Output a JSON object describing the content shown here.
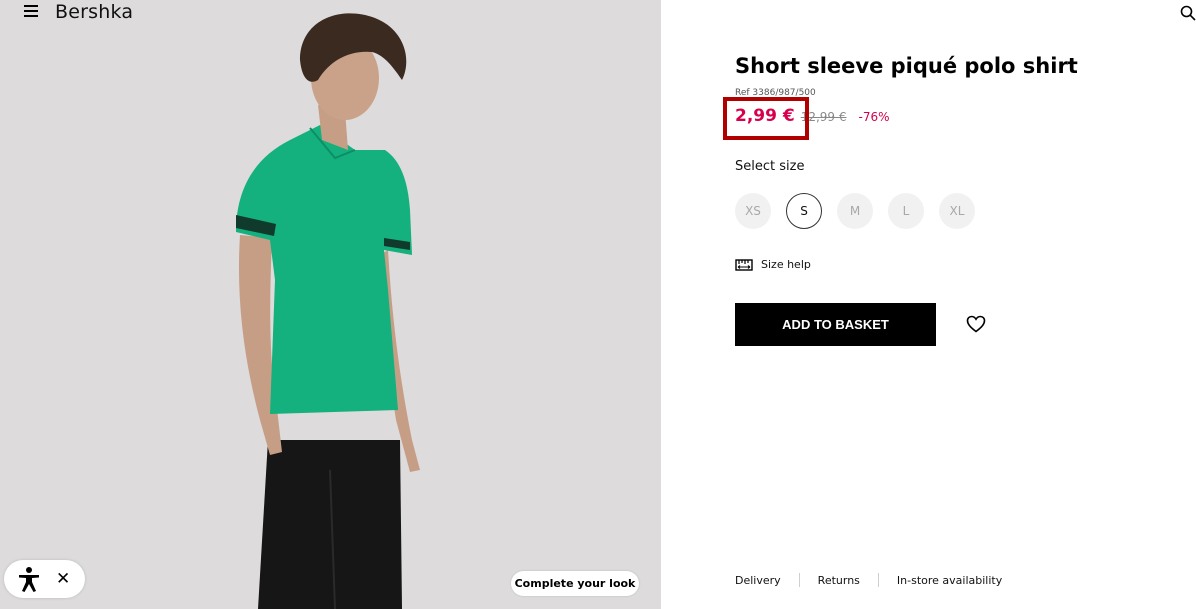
{
  "header": {
    "brand": "Bershka"
  },
  "product": {
    "title": "Short sleeve piqué polo shirt",
    "ref": "Ref 3386/987/500",
    "price_now": "2,99 €",
    "price_old": "12,99 €",
    "discount": "-76%",
    "select_size_label": "Select size",
    "sizes": [
      "XS",
      "S",
      "M",
      "L",
      "XL"
    ],
    "selected_size": "S",
    "size_help": "Size help",
    "add_to_basket": "ADD TO BASKET"
  },
  "footer": {
    "links": [
      "Delivery",
      "Returns",
      "In-store availability"
    ]
  },
  "overlay": {
    "complete_look": "Complete your look",
    "close_symbol": "✕"
  },
  "colors": {
    "accent_price": "#d6004c",
    "highlight": "#b00000",
    "shirt": "#14b07e",
    "image_bg": "#dedcdd"
  },
  "icons": [
    "menu-icon",
    "search-icon",
    "ruler-icon",
    "heart-icon",
    "accessibility-icon",
    "close-icon"
  ]
}
